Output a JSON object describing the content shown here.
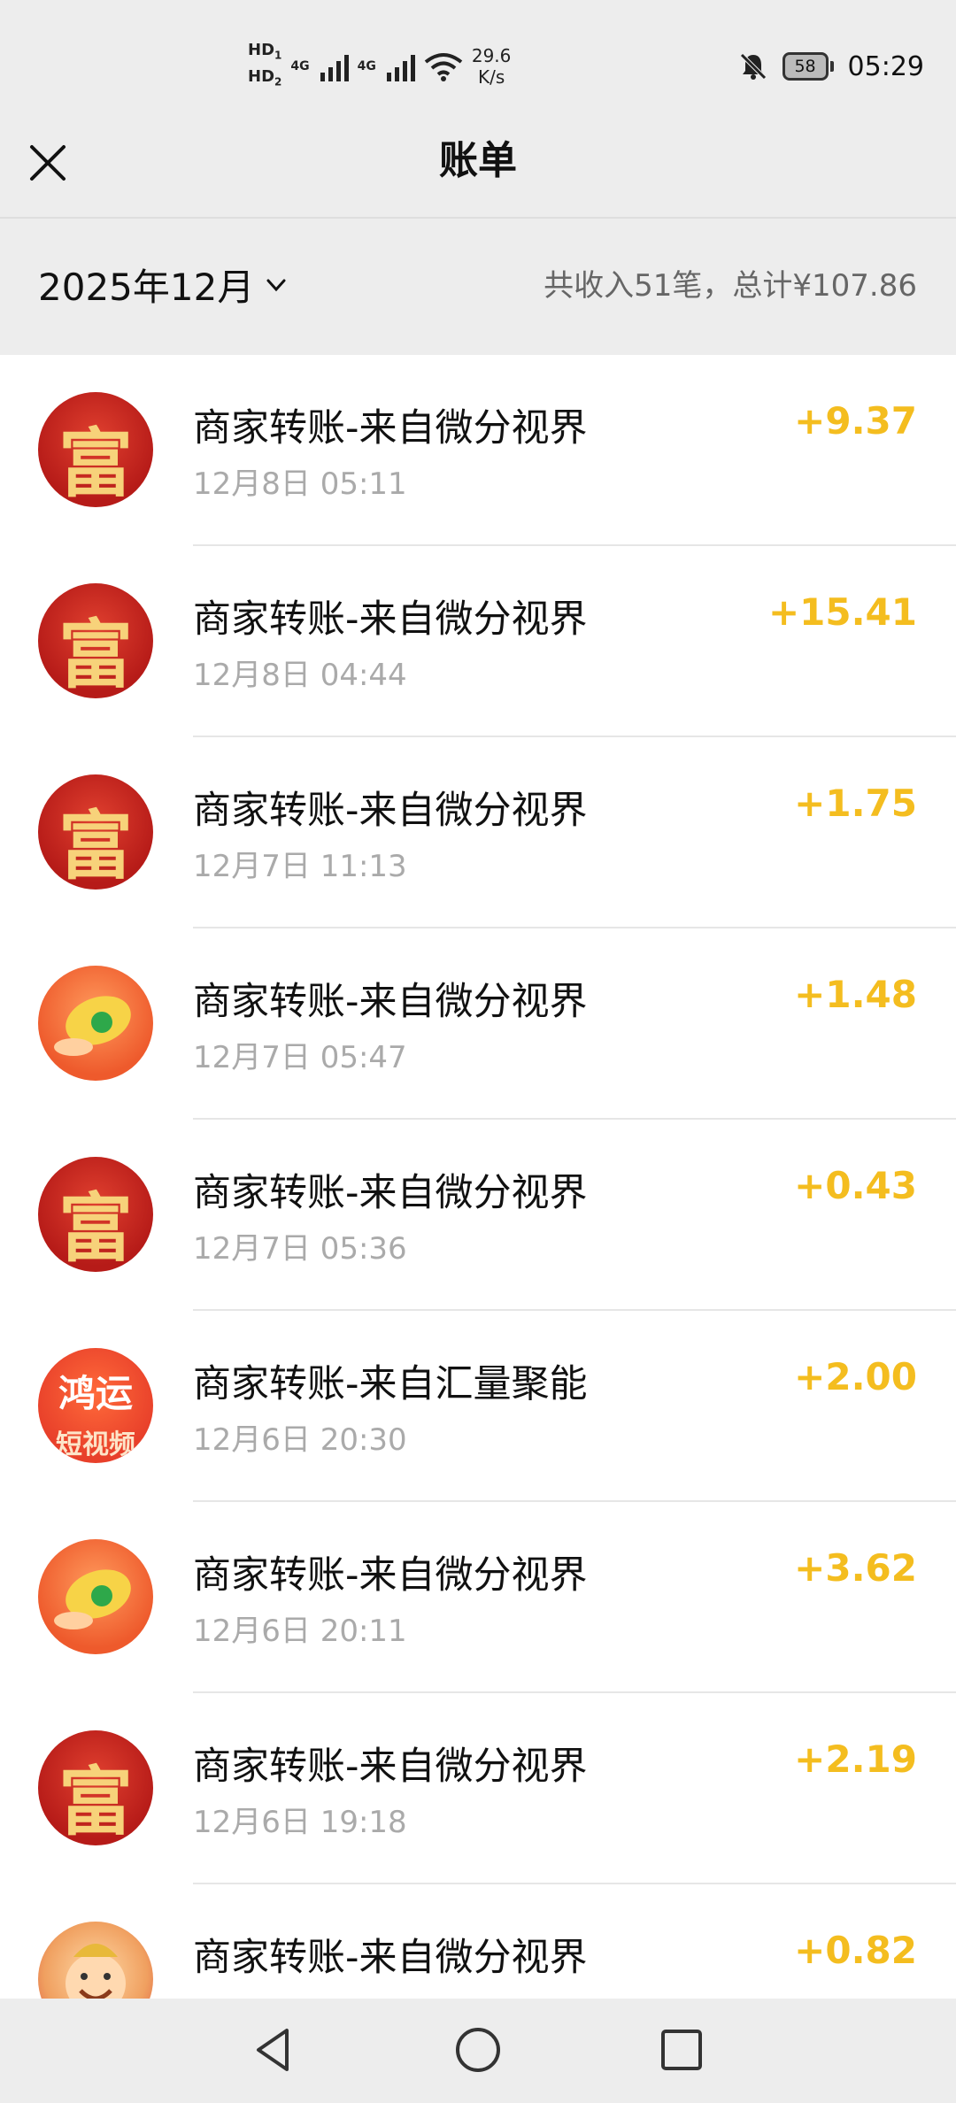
{
  "status_bar": {
    "hd1": "HD",
    "hd1_sub": "1",
    "hd2": "HD",
    "hd2_sub": "2",
    "net1": "4G",
    "net2": "4G",
    "speed_value": "29.6",
    "speed_unit": "K/s",
    "battery": "58",
    "time": "05:29",
    "icons": [
      "signal-icon",
      "wifi-icon",
      "bell-muted-icon",
      "battery-icon"
    ]
  },
  "header": {
    "title": "账单",
    "close_icon": "close-icon"
  },
  "summary": {
    "month": "2025年12月",
    "total_text": "共收入51笔，总计¥107.86"
  },
  "colors": {
    "amount": "#f4bd1f",
    "background": "#ededed",
    "list_bg": "#ffffff",
    "time_text": "#aaaaaa"
  },
  "transactions": [
    {
      "title": "商家转账-来自微分视界",
      "time": "12月8日 05:11",
      "amount": "+9.37",
      "avatar": "fu-avatar"
    },
    {
      "title": "商家转账-来自微分视界",
      "time": "12月8日 04:44",
      "amount": "+15.41",
      "avatar": "fu-avatar"
    },
    {
      "title": "商家转账-来自微分视界",
      "time": "12月7日 11:13",
      "amount": "+1.75",
      "avatar": "fu-avatar"
    },
    {
      "title": "商家转账-来自微分视界",
      "time": "12月7日 05:47",
      "amount": "+1.48",
      "avatar": "gold-nugget-avatar"
    },
    {
      "title": "商家转账-来自微分视界",
      "time": "12月7日 05:36",
      "amount": "+0.43",
      "avatar": "fu-avatar"
    },
    {
      "title": "商家转账-来自汇量聚能",
      "time": "12月6日 20:30",
      "amount": "+2.00",
      "avatar": "hongyun-avatar"
    },
    {
      "title": "商家转账-来自微分视界",
      "time": "12月6日 20:11",
      "amount": "+3.62",
      "avatar": "gold-nugget-avatar"
    },
    {
      "title": "商家转账-来自微分视界",
      "time": "12月6日 19:18",
      "amount": "+2.19",
      "avatar": "fu-avatar"
    },
    {
      "title": "商家转账-来自微分视界",
      "time": "",
      "amount": "+0.82",
      "avatar": "god-of-wealth-avatar"
    }
  ],
  "avatar_text": {
    "fu": "富",
    "hongyun_top": "鸿运",
    "hongyun_bottom": "短视频"
  },
  "nav": [
    "back-icon",
    "home-icon",
    "recents-icon"
  ]
}
